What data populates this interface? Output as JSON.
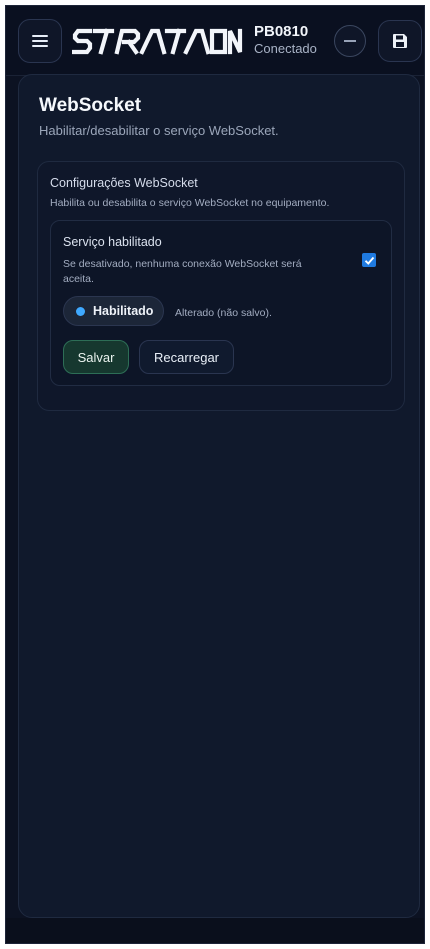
{
  "header": {
    "brand": "STRATAON",
    "device_id": "PB0810",
    "connection_status": "Conectado",
    "icons": {
      "menu": "hamburger-menu-icon",
      "minimize": "minus-circle-icon",
      "save": "floppy-disk-icon"
    }
  },
  "page": {
    "title": "WebSocket",
    "subtitle": "Habilitar/desabilitar o serviço WebSocket."
  },
  "settings_card": {
    "title": "Configurações WebSocket",
    "description": "Habilita ou desabilita o serviço WebSocket no equipamento.",
    "service": {
      "label": "Serviço habilitado",
      "description": "Se desativado, nenhuma conexão WebSocket será aceita.",
      "checked": true,
      "status_label": "Habilitado",
      "change_note": "Alterado (não salvo)."
    },
    "buttons": {
      "save": "Salvar",
      "reload": "Recarregar"
    }
  },
  "colors": {
    "background": "#0c1222",
    "panel": "#10192c",
    "accent_blue": "#1f7ae0",
    "status_dot": "#3fa9ff",
    "save_button": "#16382f"
  }
}
